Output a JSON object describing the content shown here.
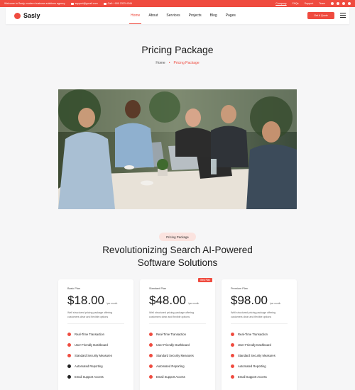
{
  "topbar": {
    "welcome": "Welcome to Sasly, modern business solutions agency",
    "email": "support@gmail.com",
    "phone": "Call: +000 2323 4346",
    "links": [
      "Company",
      "FAQs",
      "Support",
      "Team"
    ]
  },
  "header": {
    "logo": "Sasly",
    "nav": [
      "Home",
      "About",
      "Services",
      "Projects",
      "Blog",
      "Pages"
    ],
    "active_nav": "Home",
    "cta": "Get A Quote"
  },
  "page": {
    "title": "Pricing Package",
    "breadcrumb": {
      "home": "Home",
      "sep": "•",
      "current": "Pricing Package"
    }
  },
  "section": {
    "badge": "Pricing Package",
    "title_line1": "Revolutionizing Search AI-Powered",
    "title_line2": "Software Solutions"
  },
  "plans": [
    {
      "name": "Basic Plan",
      "price": "$18.00",
      "per": "/per month",
      "desc": "Well structured pricing package offering customers clear and flexible options",
      "features": [
        "Real-Time Transaction",
        "User-Friendly Dashboard",
        "Standard Security Measures",
        "Automated Reporting",
        "Email Support Access"
      ]
    },
    {
      "name": "Standard Plan",
      "price": "$48.00",
      "per": "/per month",
      "desc": "Well structured pricing package offering customers clear and flexible options",
      "popular": "Best Plan",
      "features": [
        "Real-Time Transaction",
        "User-Friendly Dashboard",
        "Standard Security Measures",
        "Automated Reporting",
        "Email Support Access"
      ]
    },
    {
      "name": "Premium Plan",
      "price": "$98.00",
      "per": "/per month",
      "desc": "Well structured pricing package offering customers clear and flexible options",
      "features": [
        "Real-Time Transaction",
        "User-Friendly Dashboard",
        "Standard Security Measures",
        "Automated Reporting",
        "Email Support Access"
      ]
    }
  ],
  "colors": {
    "accent": "#ef4b3f",
    "dark": "#111111",
    "badge_bg": "#fbe3df"
  }
}
